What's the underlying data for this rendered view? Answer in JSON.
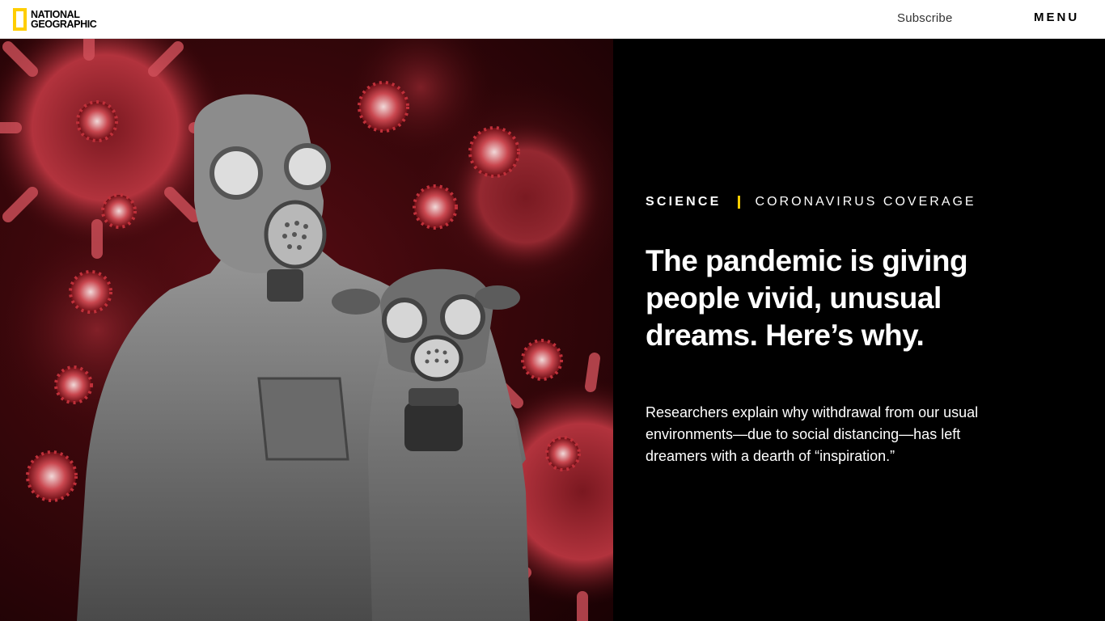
{
  "header": {
    "logo": {
      "line1": "NATIONAL",
      "line2": "GEOGRAPHIC",
      "accent_color": "#ffce00"
    },
    "subscribe_label": "Subscribe",
    "menu_label": "MENU"
  },
  "article": {
    "section": "SCIENCE",
    "series": "CORONAVIRUS COVERAGE",
    "headline": "The pandemic is giving people vivid, unusual dreams. Here’s why.",
    "dek": "Researchers explain why withdrawal from our usual environments—due to social distancing—has left dreamers with a dearth of “inspiration.”",
    "hero_image": "photo-illustration: person and lamb wearing gas masks among coronavirus particles"
  },
  "colors": {
    "accent": "#ffce00",
    "panel_bg": "#000000",
    "virus_red": "#c0303a"
  }
}
